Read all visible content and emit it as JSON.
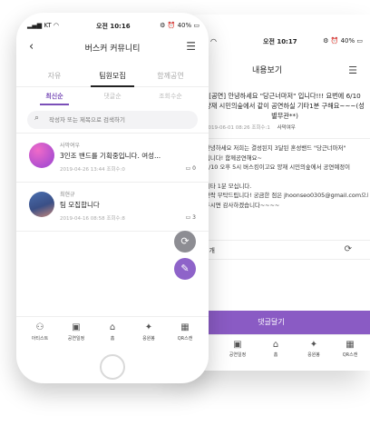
{
  "back_screen": {
    "status": {
      "time": "오전 10:17",
      "battery": "40%"
    },
    "header": {
      "title": "내용보기"
    },
    "post": {
      "title": "[공연] 안녕하세요 \"당근너마저\" 입니다!!! 요번에 6/10 양재 시민의숲에서 같이 공연하실 기타1분 구해요~~~(성별무관**)",
      "date": "2019-06-01 08:26",
      "views": "조회수:1",
      "author": "사막여우",
      "body_lines": [
        "안녕하세요 저희는 결성된지 3달된 혼성밴드 \"당근너마저\"",
        "입니다! 함께공연해요~",
        "6/10 오후 5시 버스킹이고요 양재 시민의숲에서 공연예정이",
        "",
        "기타 1분 모십니다.",
        "연락 부탁드립니다! 궁금한 점은 jhoonseo0305@gmail.com으로 컨택해",
        "주시면 감사하겠습니다~~~~"
      ],
      "comments_label": "0개"
    },
    "comment_button": "댓글달기"
  },
  "front_screen": {
    "status": {
      "carrier": "KT",
      "time": "오전 10:16",
      "battery": "40%"
    },
    "header": {
      "title": "버스커 커뮤니티"
    },
    "tabs": [
      "자유",
      "팀원모집",
      "함께공연"
    ],
    "sort": [
      "최신순",
      "댓글순",
      "조회수순"
    ],
    "search": {
      "placeholder": "작성자 또는 제목으로 검색하기"
    },
    "posts": [
      {
        "author": "사막여우",
        "title": "3인조 밴드를 기획중입니다. 여성...",
        "date": "2019-04-26 13:44",
        "views": "조회수:0",
        "comments": "0"
      },
      {
        "author": "최현규",
        "title": "팀 모집합니다",
        "date": "2019-04-16 08:58",
        "views": "조회수:8",
        "comments": "3"
      }
    ]
  },
  "bottom_nav": [
    "아티스트",
    "공연일정",
    "홈",
    "응원봉",
    "QR스캔"
  ],
  "colors": {
    "accent": "#8a5bc4",
    "fab_gray": "#8d8d93"
  }
}
